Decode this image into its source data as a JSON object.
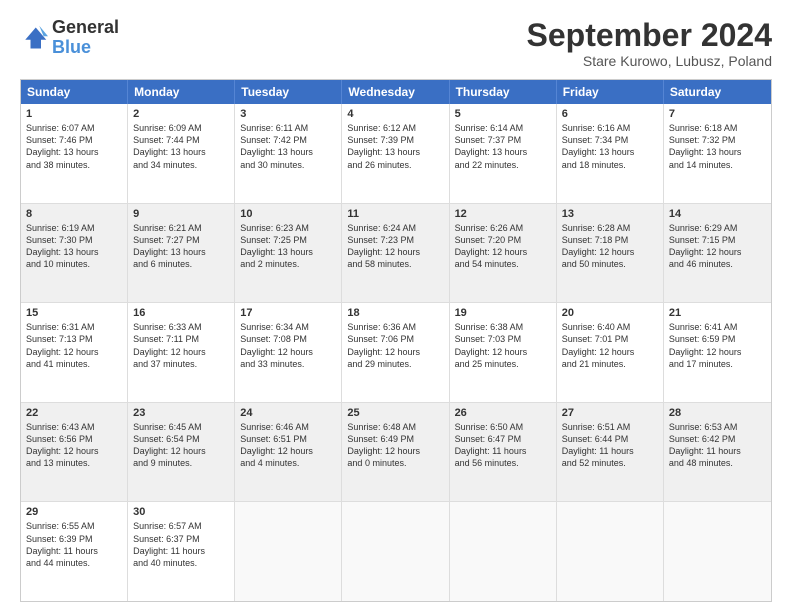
{
  "header": {
    "logo_line1": "General",
    "logo_line2": "Blue",
    "month": "September 2024",
    "location": "Stare Kurowo, Lubusz, Poland"
  },
  "weekdays": [
    "Sunday",
    "Monday",
    "Tuesday",
    "Wednesday",
    "Thursday",
    "Friday",
    "Saturday"
  ],
  "rows": [
    [
      {
        "day": "1",
        "text": "Sunrise: 6:07 AM\nSunset: 7:46 PM\nDaylight: 13 hours\nand 38 minutes.",
        "shaded": false
      },
      {
        "day": "2",
        "text": "Sunrise: 6:09 AM\nSunset: 7:44 PM\nDaylight: 13 hours\nand 34 minutes.",
        "shaded": false
      },
      {
        "day": "3",
        "text": "Sunrise: 6:11 AM\nSunset: 7:42 PM\nDaylight: 13 hours\nand 30 minutes.",
        "shaded": false
      },
      {
        "day": "4",
        "text": "Sunrise: 6:12 AM\nSunset: 7:39 PM\nDaylight: 13 hours\nand 26 minutes.",
        "shaded": false
      },
      {
        "day": "5",
        "text": "Sunrise: 6:14 AM\nSunset: 7:37 PM\nDaylight: 13 hours\nand 22 minutes.",
        "shaded": false
      },
      {
        "day": "6",
        "text": "Sunrise: 6:16 AM\nSunset: 7:34 PM\nDaylight: 13 hours\nand 18 minutes.",
        "shaded": false
      },
      {
        "day": "7",
        "text": "Sunrise: 6:18 AM\nSunset: 7:32 PM\nDaylight: 13 hours\nand 14 minutes.",
        "shaded": false
      }
    ],
    [
      {
        "day": "8",
        "text": "Sunrise: 6:19 AM\nSunset: 7:30 PM\nDaylight: 13 hours\nand 10 minutes.",
        "shaded": true
      },
      {
        "day": "9",
        "text": "Sunrise: 6:21 AM\nSunset: 7:27 PM\nDaylight: 13 hours\nand 6 minutes.",
        "shaded": true
      },
      {
        "day": "10",
        "text": "Sunrise: 6:23 AM\nSunset: 7:25 PM\nDaylight: 13 hours\nand 2 minutes.",
        "shaded": true
      },
      {
        "day": "11",
        "text": "Sunrise: 6:24 AM\nSunset: 7:23 PM\nDaylight: 12 hours\nand 58 minutes.",
        "shaded": true
      },
      {
        "day": "12",
        "text": "Sunrise: 6:26 AM\nSunset: 7:20 PM\nDaylight: 12 hours\nand 54 minutes.",
        "shaded": true
      },
      {
        "day": "13",
        "text": "Sunrise: 6:28 AM\nSunset: 7:18 PM\nDaylight: 12 hours\nand 50 minutes.",
        "shaded": true
      },
      {
        "day": "14",
        "text": "Sunrise: 6:29 AM\nSunset: 7:15 PM\nDaylight: 12 hours\nand 46 minutes.",
        "shaded": true
      }
    ],
    [
      {
        "day": "15",
        "text": "Sunrise: 6:31 AM\nSunset: 7:13 PM\nDaylight: 12 hours\nand 41 minutes.",
        "shaded": false
      },
      {
        "day": "16",
        "text": "Sunrise: 6:33 AM\nSunset: 7:11 PM\nDaylight: 12 hours\nand 37 minutes.",
        "shaded": false
      },
      {
        "day": "17",
        "text": "Sunrise: 6:34 AM\nSunset: 7:08 PM\nDaylight: 12 hours\nand 33 minutes.",
        "shaded": false
      },
      {
        "day": "18",
        "text": "Sunrise: 6:36 AM\nSunset: 7:06 PM\nDaylight: 12 hours\nand 29 minutes.",
        "shaded": false
      },
      {
        "day": "19",
        "text": "Sunrise: 6:38 AM\nSunset: 7:03 PM\nDaylight: 12 hours\nand 25 minutes.",
        "shaded": false
      },
      {
        "day": "20",
        "text": "Sunrise: 6:40 AM\nSunset: 7:01 PM\nDaylight: 12 hours\nand 21 minutes.",
        "shaded": false
      },
      {
        "day": "21",
        "text": "Sunrise: 6:41 AM\nSunset: 6:59 PM\nDaylight: 12 hours\nand 17 minutes.",
        "shaded": false
      }
    ],
    [
      {
        "day": "22",
        "text": "Sunrise: 6:43 AM\nSunset: 6:56 PM\nDaylight: 12 hours\nand 13 minutes.",
        "shaded": true
      },
      {
        "day": "23",
        "text": "Sunrise: 6:45 AM\nSunset: 6:54 PM\nDaylight: 12 hours\nand 9 minutes.",
        "shaded": true
      },
      {
        "day": "24",
        "text": "Sunrise: 6:46 AM\nSunset: 6:51 PM\nDaylight: 12 hours\nand 4 minutes.",
        "shaded": true
      },
      {
        "day": "25",
        "text": "Sunrise: 6:48 AM\nSunset: 6:49 PM\nDaylight: 12 hours\nand 0 minutes.",
        "shaded": true
      },
      {
        "day": "26",
        "text": "Sunrise: 6:50 AM\nSunset: 6:47 PM\nDaylight: 11 hours\nand 56 minutes.",
        "shaded": true
      },
      {
        "day": "27",
        "text": "Sunrise: 6:51 AM\nSunset: 6:44 PM\nDaylight: 11 hours\nand 52 minutes.",
        "shaded": true
      },
      {
        "day": "28",
        "text": "Sunrise: 6:53 AM\nSunset: 6:42 PM\nDaylight: 11 hours\nand 48 minutes.",
        "shaded": true
      }
    ],
    [
      {
        "day": "29",
        "text": "Sunrise: 6:55 AM\nSunset: 6:39 PM\nDaylight: 11 hours\nand 44 minutes.",
        "shaded": false
      },
      {
        "day": "30",
        "text": "Sunrise: 6:57 AM\nSunset: 6:37 PM\nDaylight: 11 hours\nand 40 minutes.",
        "shaded": false
      },
      {
        "day": "",
        "text": "",
        "shaded": false,
        "empty": true
      },
      {
        "day": "",
        "text": "",
        "shaded": false,
        "empty": true
      },
      {
        "day": "",
        "text": "",
        "shaded": false,
        "empty": true
      },
      {
        "day": "",
        "text": "",
        "shaded": false,
        "empty": true
      },
      {
        "day": "",
        "text": "",
        "shaded": false,
        "empty": true
      }
    ]
  ]
}
